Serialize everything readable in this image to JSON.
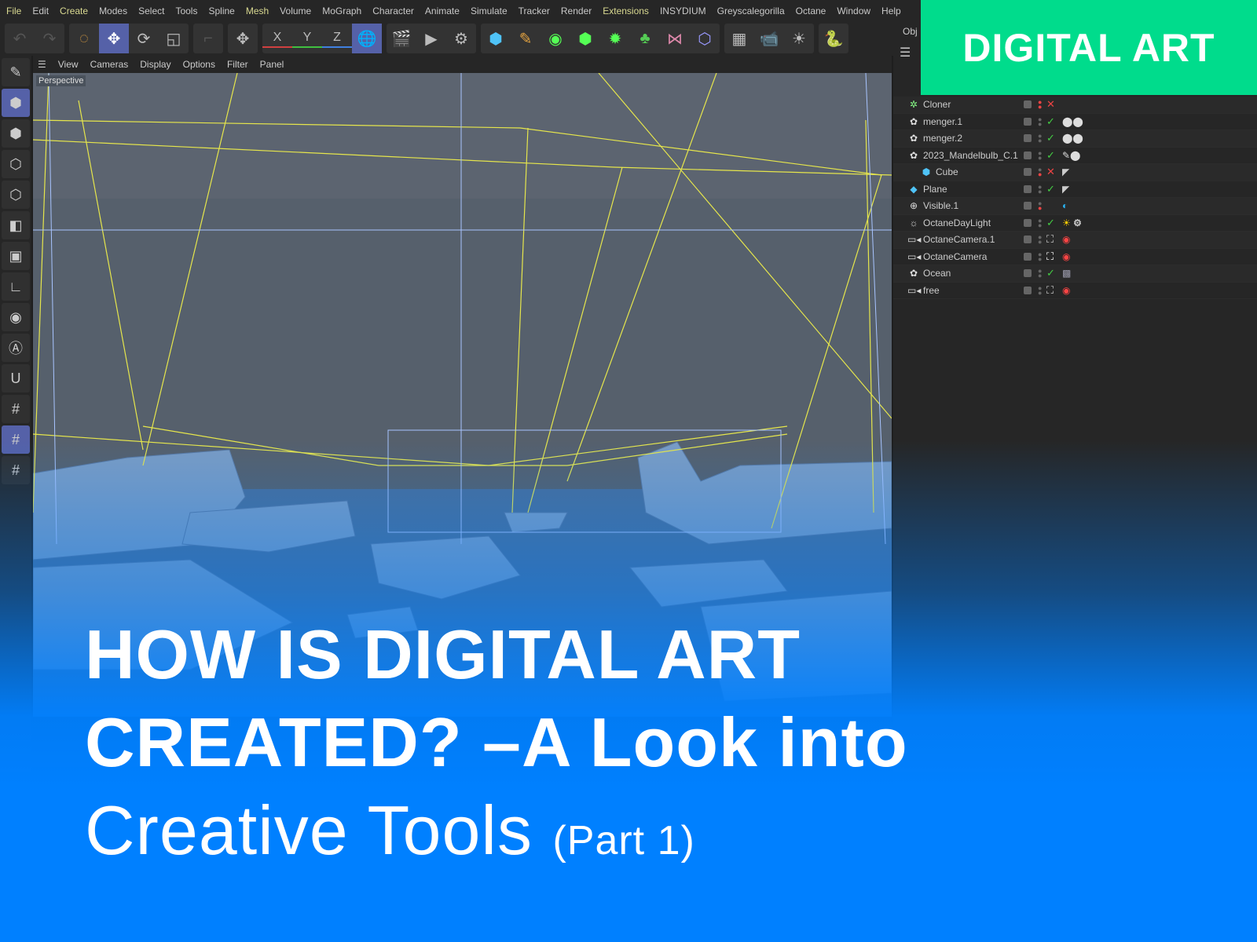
{
  "menu": [
    "File",
    "Edit",
    "Create",
    "Modes",
    "Select",
    "Tools",
    "Spline",
    "Mesh",
    "Volume",
    "MoGraph",
    "Character",
    "Animate",
    "Simulate",
    "Tracker",
    "Render",
    "Extensions",
    "INSYDIUM",
    "Greyscalegorilla",
    "Octane",
    "Window",
    "Help"
  ],
  "toolbar": {
    "x": "X",
    "y": "Y",
    "z": "Z"
  },
  "viewport_menu": [
    "View",
    "Cameras",
    "Display",
    "Options",
    "Filter",
    "Panel"
  ],
  "viewport_label": "Perspective",
  "object_panel": {
    "tab": "Obj",
    "objects": [
      {
        "name": "Cloner",
        "icon": "cloner-icon",
        "status": "x"
      },
      {
        "name": "menger.1",
        "icon": "generator-icon",
        "status": "check"
      },
      {
        "name": "menger.2",
        "icon": "generator-icon",
        "status": "check"
      },
      {
        "name": "2023_Mandelbulb_C.1",
        "icon": "generator-icon",
        "status": "check"
      },
      {
        "name": "Cube",
        "icon": "cube-icon",
        "status": "x"
      },
      {
        "name": "Plane",
        "icon": "plane-icon",
        "status": "check"
      },
      {
        "name": "Visible.1",
        "icon": "visible-icon",
        "status": ""
      },
      {
        "name": "OctaneDayLight",
        "icon": "light-icon",
        "status": "check"
      },
      {
        "name": "OctaneCamera.1",
        "icon": "camera-icon",
        "status": ""
      },
      {
        "name": "OctaneCamera",
        "icon": "camera-icon",
        "status": ""
      },
      {
        "name": "Ocean",
        "icon": "generator-icon",
        "status": "check"
      },
      {
        "name": "free",
        "icon": "camera-icon",
        "status": ""
      }
    ]
  },
  "banner": "DIGITAL ART",
  "headline": {
    "line1": "HOW IS DIGITAL ART",
    "line2": "CREATED? –A Look into",
    "line3": "Creative Tools",
    "line3_suffix": "(Part 1)"
  },
  "colors": {
    "banner": "#00dc8c",
    "overlay": "#0080ff"
  }
}
